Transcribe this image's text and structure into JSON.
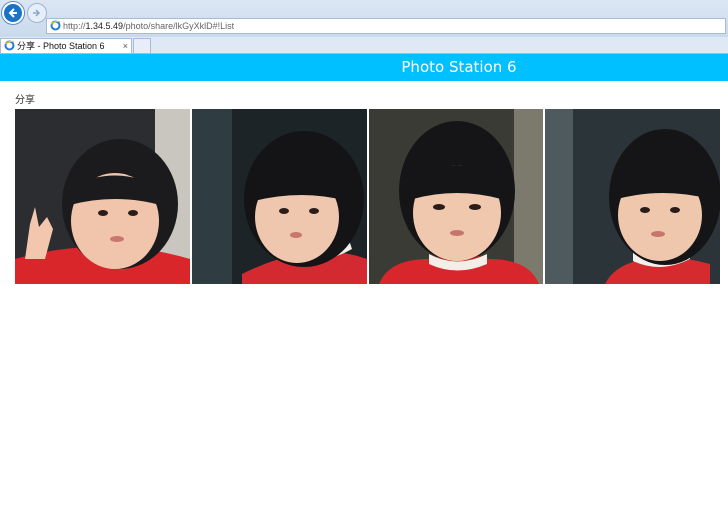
{
  "browser": {
    "url_prefix": "http://",
    "url_host": "1.34.5.49",
    "url_path": "/photo/share/lkGyXklD#!List",
    "tab_title": "分享 - Photo Station 6",
    "tab_close": "×"
  },
  "app": {
    "title": "Photo Station 6"
  },
  "page": {
    "section_label": "分享"
  },
  "gallery": {
    "photos": [
      {
        "alt": "Child portrait 1"
      },
      {
        "alt": "Child portrait 2"
      },
      {
        "alt": "Child portrait 3"
      },
      {
        "alt": "Child portrait 4"
      }
    ]
  },
  "colors": {
    "header_bg": "#00c0ff",
    "back_button": "#1a73c6"
  }
}
